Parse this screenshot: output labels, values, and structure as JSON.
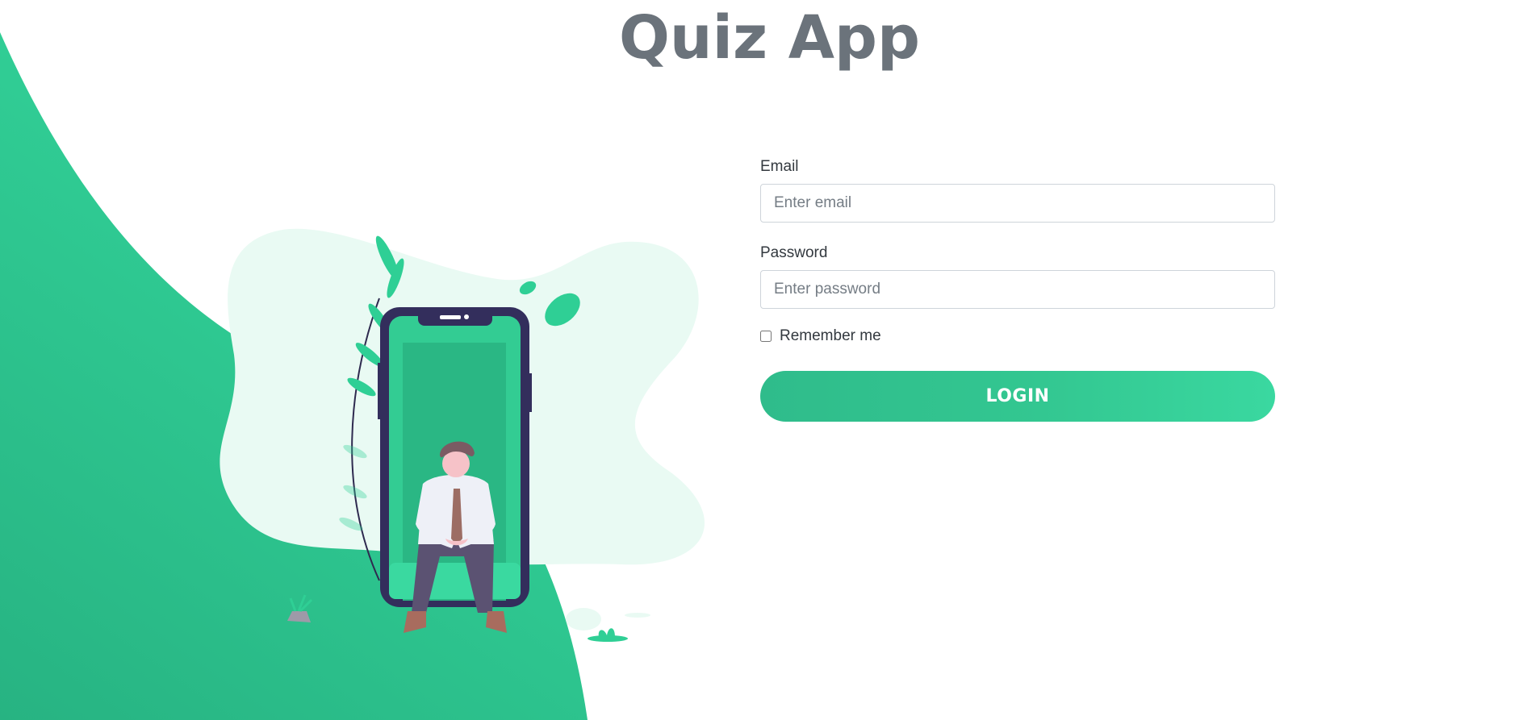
{
  "app": {
    "title": "Quiz App"
  },
  "form": {
    "email_label": "Email",
    "email_placeholder": "Enter email",
    "email_value": "",
    "password_label": "Password",
    "password_placeholder": "Enter password",
    "password_value": "",
    "remember_label": "Remember me",
    "remember_checked": false,
    "login_label": "LOGIN"
  },
  "colors": {
    "accent": "#32c28e",
    "title": "#6b737b",
    "blob": "#e9faf3",
    "phone": "#332e5c"
  },
  "illustration": {
    "icon": "person-on-phone-illustration"
  }
}
